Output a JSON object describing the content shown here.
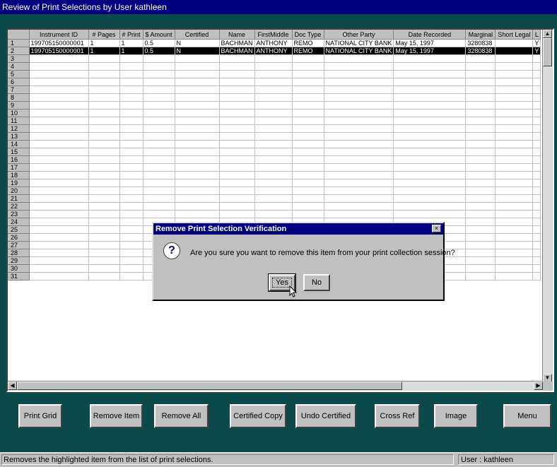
{
  "window": {
    "title": "Review of Print Selections by User kathleen"
  },
  "grid": {
    "columns": [
      "",
      "Instrument ID",
      "# Pages",
      "# Print",
      "$ Amount",
      "Certified",
      "Name",
      "FirstMiddle",
      "Doc Type",
      "Other Party",
      "Date Recorded",
      "Marginal",
      "Short Legal",
      "L"
    ],
    "rows": [
      [
        "1",
        "199705150000001",
        "1",
        "1",
        "0.5",
        "N",
        "BACHMAN",
        "ANTHONY",
        "REMO",
        "NATIONAL CITY BANK",
        "May 15, 1997",
        "3280838",
        "",
        "Y"
      ],
      [
        "2",
        "199705150000001",
        "1",
        "1",
        "0.5",
        "N",
        "BACHMAN",
        "ANTHONY",
        "REMO",
        "NATIONAL CITY BANK",
        "May 15, 1997",
        "3280838",
        "",
        "Y"
      ],
      [
        "3"
      ],
      [
        "4"
      ],
      [
        "5"
      ],
      [
        "6"
      ],
      [
        "7"
      ],
      [
        "8"
      ],
      [
        "9"
      ],
      [
        "10"
      ],
      [
        "11"
      ],
      [
        "12"
      ],
      [
        "13"
      ],
      [
        "14"
      ],
      [
        "15"
      ],
      [
        "16"
      ],
      [
        "17"
      ],
      [
        "18"
      ],
      [
        "19"
      ],
      [
        "20"
      ],
      [
        "21"
      ],
      [
        "22"
      ],
      [
        "23"
      ],
      [
        "24"
      ],
      [
        "25"
      ],
      [
        "26"
      ],
      [
        "27"
      ],
      [
        "28"
      ],
      [
        "29"
      ],
      [
        "30"
      ],
      [
        "31"
      ]
    ],
    "selected_row": 1
  },
  "buttons": {
    "print_grid": "Print Grid",
    "remove_item": "Remove Item",
    "remove_all": "Remove All",
    "certified_copy": "Certified Copy",
    "undo_certified": "Undo Certified",
    "cross_ref": "Cross Ref",
    "image": "Image",
    "menu": "Menu"
  },
  "status": {
    "message": "Removes the highlighted item from the list of print selections.",
    "user": "User : kathleen"
  },
  "dialog": {
    "title": "Remove Print Selection Verification",
    "message": "Are you sure you want to remove this item from your print collection session?",
    "yes": "Yes",
    "no": "No",
    "icon": "question-icon"
  }
}
